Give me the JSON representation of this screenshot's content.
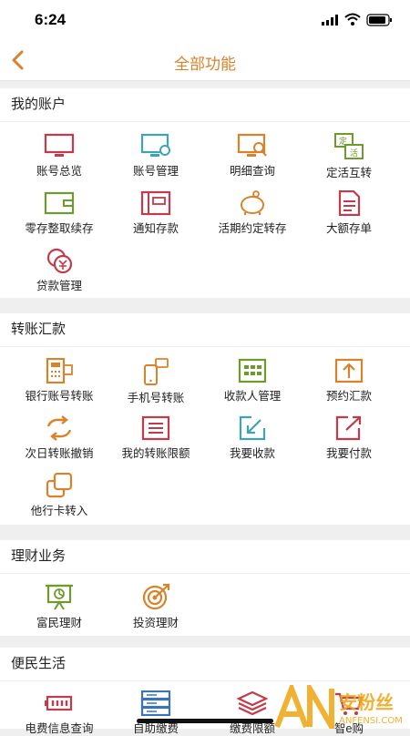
{
  "status": {
    "time": "6:24"
  },
  "nav": {
    "title": "全部功能"
  },
  "sections": [
    {
      "title": "我的账户",
      "items": [
        "账号总览",
        "账号管理",
        "明细查询",
        "定活互转",
        "零存整取续存",
        "通知存款",
        "活期约定转存",
        "大额存单",
        "贷款管理"
      ]
    },
    {
      "title": "转账汇款",
      "items": [
        "银行账号转账",
        "手机号转账",
        "收款人管理",
        "预约汇款",
        "次日转账撤销",
        "我的转账限额",
        "我要收款",
        "我要付款",
        "他行卡转入"
      ]
    },
    {
      "title": "理财业务",
      "items": [
        "富民理财",
        "投资理财"
      ]
    },
    {
      "title": "便民生活",
      "items": [
        "电费信息查询",
        "自助缴费",
        "缴费限额",
        "智e购"
      ]
    }
  ],
  "icon_text": {
    "ding": "定",
    "huo": "活"
  },
  "watermark": {
    "text": "安粉丝",
    "sub": "ANFENSI.COM"
  },
  "colors": {
    "accent": "#d9822b",
    "red": "#c33b4b",
    "teal": "#3fa3b3",
    "green": "#6f9a2e",
    "blue": "#3b72b8"
  }
}
